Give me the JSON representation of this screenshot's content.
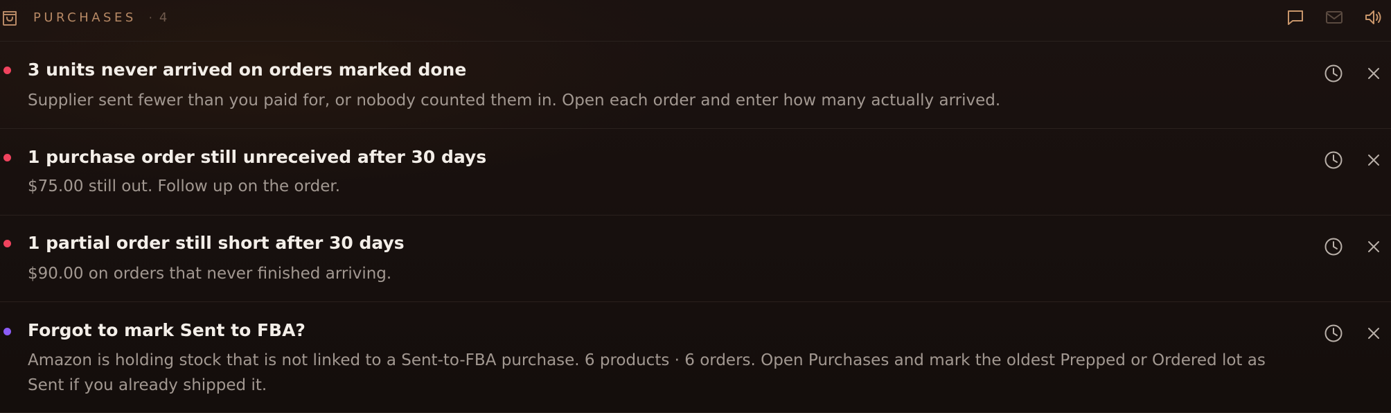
{
  "header": {
    "title": "PURCHASES",
    "separator": "·",
    "count": "4",
    "icons": {
      "section": "shopping-bag-icon",
      "chat": "chat-bubble-icon",
      "mail": "mail-icon",
      "sound": "speaker-icon"
    }
  },
  "alerts": [
    {
      "title": "3 units never arrived on orders marked done",
      "description": "Supplier sent fewer than you paid for, or nobody counted them in. Open each order and enter how many actually arrived.",
      "dot_color": "#f0435e"
    },
    {
      "title": "1 purchase order still unreceived after 30 days",
      "description": "$75.00 still out. Follow up on the order.",
      "dot_color": "#f0435e"
    },
    {
      "title": "1 partial order still short after 30 days",
      "description": "$90.00 on orders that never finished arriving.",
      "dot_color": "#f0435e"
    },
    {
      "title": "Forgot to mark Sent to FBA?",
      "description": "Amazon is holding stock that is not linked to a Sent-to-FBA purchase. 6 products · 6 orders. Open Purchases and mark the oldest Prepped or Ordered lot as Sent if you already shipped it.",
      "dot_color": "#8b5cf6"
    }
  ],
  "row_actions": {
    "snooze_icon": "clock-icon",
    "dismiss_icon": "close-icon"
  },
  "colors": {
    "background": "#161010",
    "accent": "#b78965",
    "urgent": "#f0435e",
    "info": "#8b5cf6"
  }
}
